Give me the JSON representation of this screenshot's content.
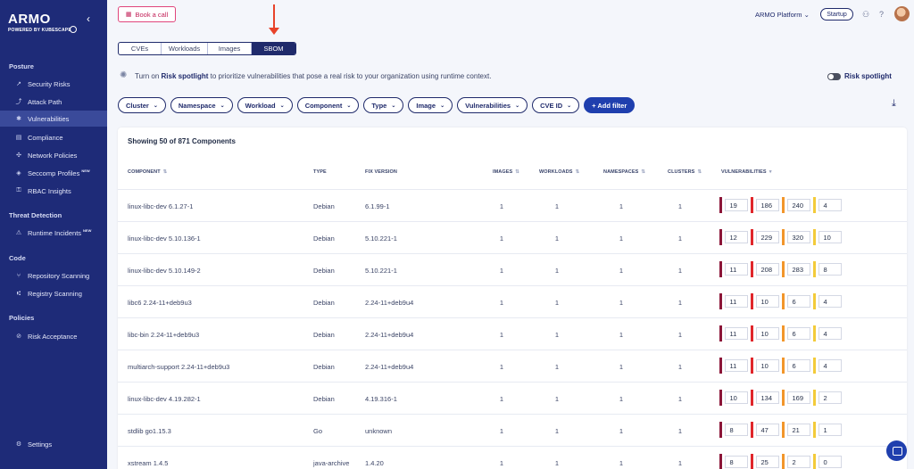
{
  "brand": {
    "name": "ARMO",
    "tagline": "POWERED BY KUBESCAPE"
  },
  "sidebar": {
    "sections": {
      "posture": "Posture",
      "threat": "Threat Detection",
      "code": "Code",
      "policies": "Policies"
    },
    "items": [
      {
        "label": "Security Risks",
        "icon": "trend-icon"
      },
      {
        "label": "Attack Path",
        "icon": "path-icon"
      },
      {
        "label": "Vulnerabilities",
        "icon": "bug-icon"
      },
      {
        "label": "Compliance",
        "icon": "clipboard-icon"
      },
      {
        "label": "Network Policies",
        "icon": "network-icon"
      },
      {
        "label": "Seccomp Profiles",
        "icon": "shield-icon",
        "badge": "NEW"
      },
      {
        "label": "RBAC Insights",
        "icon": "rbac-icon"
      },
      {
        "label": "Runtime Incidents",
        "icon": "alert-icon",
        "badge": "NEW"
      },
      {
        "label": "Repository Scanning",
        "icon": "repo-icon"
      },
      {
        "label": "Registry Scanning",
        "icon": "registry-icon"
      },
      {
        "label": "Risk Acceptance",
        "icon": "accept-icon"
      },
      {
        "label": "Settings",
        "icon": "gear-icon"
      }
    ]
  },
  "topbar": {
    "book_call": "Book a call",
    "platform": "ARMO Platform",
    "plan": "Startup"
  },
  "tabs": [
    "CVEs",
    "Workloads",
    "Images",
    "SBOM"
  ],
  "spotlight": {
    "prefix": "Turn on ",
    "bold": "Risk spotlight",
    "suffix": " to prioritize vulnerabilities that pose a real risk to your organization using runtime context.",
    "toggle_label": "Risk spotlight"
  },
  "filters": [
    "Cluster",
    "Namespace",
    "Workload",
    "Component",
    "Type",
    "Image",
    "Vulnerabilities",
    "CVE ID"
  ],
  "add_filter": "+ Add filter",
  "table": {
    "title": "Showing 50 of 871 Components",
    "headers": {
      "component": "COMPONENT",
      "type": "TYPE",
      "fix": "FIX VERSION",
      "images": "IMAGES",
      "workloads": "WORKLOADS",
      "namespaces": "NAMESPACES",
      "clusters": "CLUSTERS",
      "vulns": "VULNERABILITIES"
    },
    "severity_colors": {
      "critical": "#8b1538",
      "high": "#e0262b",
      "medium": "#f2962b",
      "low": "#f3cb3a"
    },
    "rows": [
      {
        "component": "linux-libc-dev 6.1.27-1",
        "type": "Debian",
        "fix": "6.1.99-1",
        "images": "1",
        "workloads": "1",
        "namespaces": "1",
        "clusters": "1",
        "v": [
          "19",
          "186",
          "240",
          "4"
        ]
      },
      {
        "component": "linux-libc-dev 5.10.136-1",
        "type": "Debian",
        "fix": "5.10.221-1",
        "images": "1",
        "workloads": "1",
        "namespaces": "1",
        "clusters": "1",
        "v": [
          "12",
          "229",
          "320",
          "10"
        ]
      },
      {
        "component": "linux-libc-dev 5.10.149-2",
        "type": "Debian",
        "fix": "5.10.221-1",
        "images": "1",
        "workloads": "1",
        "namespaces": "1",
        "clusters": "1",
        "v": [
          "11",
          "208",
          "283",
          "8"
        ]
      },
      {
        "component": "libc6 2.24-11+deb9u3",
        "type": "Debian",
        "fix": "2.24-11+deb9u4",
        "images": "1",
        "workloads": "1",
        "namespaces": "1",
        "clusters": "1",
        "v": [
          "11",
          "10",
          "6",
          "4"
        ]
      },
      {
        "component": "libc-bin 2.24-11+deb9u3",
        "type": "Debian",
        "fix": "2.24-11+deb9u4",
        "images": "1",
        "workloads": "1",
        "namespaces": "1",
        "clusters": "1",
        "v": [
          "11",
          "10",
          "6",
          "4"
        ]
      },
      {
        "component": "multiarch-support 2.24-11+deb9u3",
        "type": "Debian",
        "fix": "2.24-11+deb9u4",
        "images": "1",
        "workloads": "1",
        "namespaces": "1",
        "clusters": "1",
        "v": [
          "11",
          "10",
          "6",
          "4"
        ]
      },
      {
        "component": "linux-libc-dev 4.19.282-1",
        "type": "Debian",
        "fix": "4.19.316-1",
        "images": "1",
        "workloads": "1",
        "namespaces": "1",
        "clusters": "1",
        "v": [
          "10",
          "134",
          "169",
          "2"
        ]
      },
      {
        "component": "stdlib go1.15.3",
        "type": "Go",
        "fix": "unknown",
        "images": "1",
        "workloads": "1",
        "namespaces": "1",
        "clusters": "1",
        "v": [
          "8",
          "47",
          "21",
          "1"
        ]
      },
      {
        "component": "xstream 1.4.5",
        "type": "java-archive",
        "fix": "1.4.20",
        "images": "1",
        "workloads": "1",
        "namespaces": "1",
        "clusters": "1",
        "v": [
          "8",
          "25",
          "2",
          "0"
        ]
      }
    ]
  }
}
